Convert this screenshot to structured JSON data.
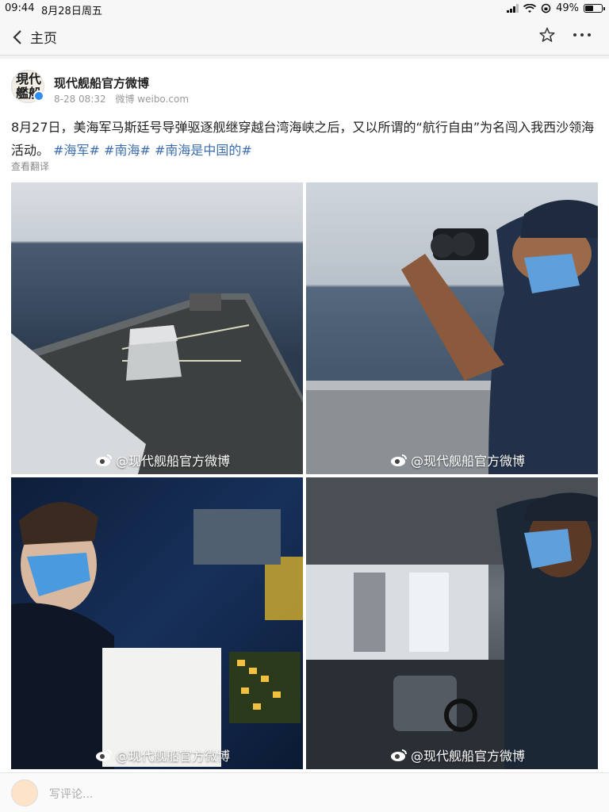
{
  "status": {
    "time": "09:44",
    "date": "8月28日周五",
    "battery": "49%",
    "battery_level": 0.49
  },
  "nav": {
    "back_label": "主页"
  },
  "post": {
    "username": "现代舰船官方微博",
    "avatar_text": "現代艦船",
    "timestamp": "8-28 08:32",
    "source": "微博 weibo.com",
    "body": "8月27日，美海军马斯廷号导弹驱逐舰继穿越台湾海峡之后，又以所谓的“航行自由”为名闯入我西沙领海活动。",
    "tags": [
      "#海军#",
      "#南海#",
      "#南海是中国的#"
    ],
    "translate_label": "查看翻译",
    "watermark": "@现代舰船官方微博"
  },
  "composer": {
    "placeholder": "写评论..."
  }
}
